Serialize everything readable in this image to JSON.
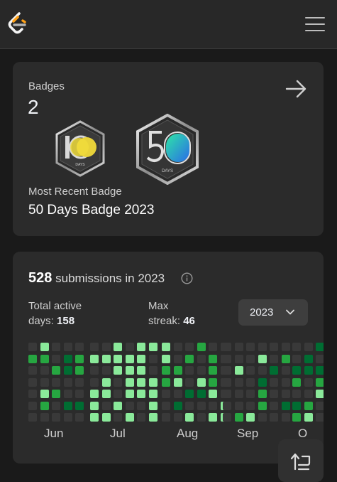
{
  "topbar": {
    "logo_icon": "leetcode-logo-icon",
    "menu_icon": "hamburger-menu-icon"
  },
  "badges": {
    "label": "Badges",
    "count": "2",
    "arrow_icon": "arrow-right-icon",
    "items": [
      {
        "name": "100 Days Badge",
        "number": "100",
        "caption": "DAYS",
        "accent": "#e8d23a"
      },
      {
        "name": "50 Days Badge",
        "number": "50",
        "caption": "DAYS",
        "accent": "#2ec8c8"
      }
    ],
    "recent_label": "Most Recent Badge",
    "recent_name": "50 Days Badge 2023"
  },
  "submissions": {
    "count": "528",
    "text": "submissions in 2023",
    "info_icon": "info-icon",
    "total_active_label_1": "Total active",
    "total_active_label_2": "days:",
    "total_active_value": "158",
    "max_streak_label_1": "Max",
    "max_streak_label_2": "streak:",
    "max_streak_value": "46",
    "year": "2023",
    "months": [
      "Jun",
      "Jul",
      "Aug",
      "Sep",
      "O"
    ],
    "colors": {
      "empty": "#393939",
      "l1": "#0e4429",
      "l2": "#006d32",
      "l3": "#26a641",
      "l4": "#8ae99a"
    }
  },
  "float_button_icon": "switch-layout-icon"
}
